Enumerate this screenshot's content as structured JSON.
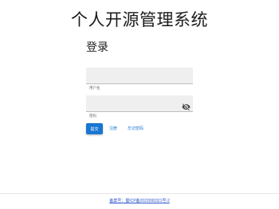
{
  "header": {
    "title": "个人开源管理系统"
  },
  "login": {
    "heading": "登录",
    "username": {
      "label": "用户名",
      "value": "",
      "placeholder": ""
    },
    "password": {
      "label": "密码",
      "value": "",
      "placeholder": "",
      "toggle_icon": "visibility-off-icon"
    },
    "submit_label": "提交",
    "register_label": "注册",
    "forgot_label": "忘记密码"
  },
  "footer": {
    "icp_text": "备案号：蜀ICP备2022000321号-2"
  },
  "colors": {
    "primary": "#1976d2",
    "field_background": "#efefef",
    "footer_link": "#2a55c9"
  }
}
